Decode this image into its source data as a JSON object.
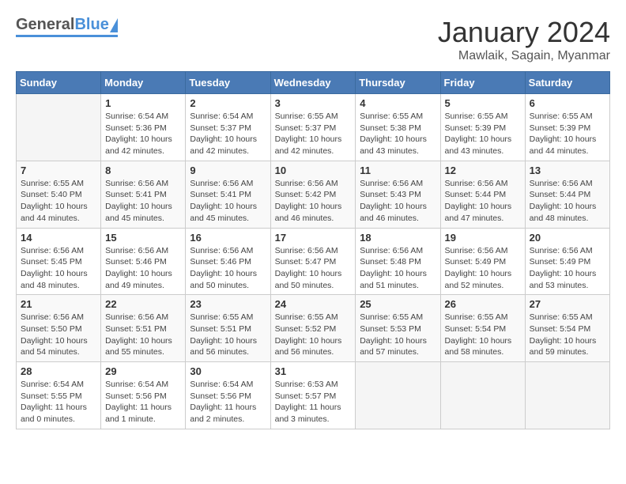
{
  "header": {
    "logo_general": "General",
    "logo_blue": "Blue",
    "month_title": "January 2024",
    "location": "Mawlaik, Sagain, Myanmar"
  },
  "days_of_week": [
    "Sunday",
    "Monday",
    "Tuesday",
    "Wednesday",
    "Thursday",
    "Friday",
    "Saturday"
  ],
  "weeks": [
    [
      {
        "day": "",
        "sunrise": "",
        "sunset": "",
        "daylight": ""
      },
      {
        "day": "1",
        "sunrise": "Sunrise: 6:54 AM",
        "sunset": "Sunset: 5:36 PM",
        "daylight": "Daylight: 10 hours and 42 minutes."
      },
      {
        "day": "2",
        "sunrise": "Sunrise: 6:54 AM",
        "sunset": "Sunset: 5:37 PM",
        "daylight": "Daylight: 10 hours and 42 minutes."
      },
      {
        "day": "3",
        "sunrise": "Sunrise: 6:55 AM",
        "sunset": "Sunset: 5:37 PM",
        "daylight": "Daylight: 10 hours and 42 minutes."
      },
      {
        "day": "4",
        "sunrise": "Sunrise: 6:55 AM",
        "sunset": "Sunset: 5:38 PM",
        "daylight": "Daylight: 10 hours and 43 minutes."
      },
      {
        "day": "5",
        "sunrise": "Sunrise: 6:55 AM",
        "sunset": "Sunset: 5:39 PM",
        "daylight": "Daylight: 10 hours and 43 minutes."
      },
      {
        "day": "6",
        "sunrise": "Sunrise: 6:55 AM",
        "sunset": "Sunset: 5:39 PM",
        "daylight": "Daylight: 10 hours and 44 minutes."
      }
    ],
    [
      {
        "day": "7",
        "sunrise": "Sunrise: 6:55 AM",
        "sunset": "Sunset: 5:40 PM",
        "daylight": "Daylight: 10 hours and 44 minutes."
      },
      {
        "day": "8",
        "sunrise": "Sunrise: 6:56 AM",
        "sunset": "Sunset: 5:41 PM",
        "daylight": "Daylight: 10 hours and 45 minutes."
      },
      {
        "day": "9",
        "sunrise": "Sunrise: 6:56 AM",
        "sunset": "Sunset: 5:41 PM",
        "daylight": "Daylight: 10 hours and 45 minutes."
      },
      {
        "day": "10",
        "sunrise": "Sunrise: 6:56 AM",
        "sunset": "Sunset: 5:42 PM",
        "daylight": "Daylight: 10 hours and 46 minutes."
      },
      {
        "day": "11",
        "sunrise": "Sunrise: 6:56 AM",
        "sunset": "Sunset: 5:43 PM",
        "daylight": "Daylight: 10 hours and 46 minutes."
      },
      {
        "day": "12",
        "sunrise": "Sunrise: 6:56 AM",
        "sunset": "Sunset: 5:44 PM",
        "daylight": "Daylight: 10 hours and 47 minutes."
      },
      {
        "day": "13",
        "sunrise": "Sunrise: 6:56 AM",
        "sunset": "Sunset: 5:44 PM",
        "daylight": "Daylight: 10 hours and 48 minutes."
      }
    ],
    [
      {
        "day": "14",
        "sunrise": "Sunrise: 6:56 AM",
        "sunset": "Sunset: 5:45 PM",
        "daylight": "Daylight: 10 hours and 48 minutes."
      },
      {
        "day": "15",
        "sunrise": "Sunrise: 6:56 AM",
        "sunset": "Sunset: 5:46 PM",
        "daylight": "Daylight: 10 hours and 49 minutes."
      },
      {
        "day": "16",
        "sunrise": "Sunrise: 6:56 AM",
        "sunset": "Sunset: 5:46 PM",
        "daylight": "Daylight: 10 hours and 50 minutes."
      },
      {
        "day": "17",
        "sunrise": "Sunrise: 6:56 AM",
        "sunset": "Sunset: 5:47 PM",
        "daylight": "Daylight: 10 hours and 50 minutes."
      },
      {
        "day": "18",
        "sunrise": "Sunrise: 6:56 AM",
        "sunset": "Sunset: 5:48 PM",
        "daylight": "Daylight: 10 hours and 51 minutes."
      },
      {
        "day": "19",
        "sunrise": "Sunrise: 6:56 AM",
        "sunset": "Sunset: 5:49 PM",
        "daylight": "Daylight: 10 hours and 52 minutes."
      },
      {
        "day": "20",
        "sunrise": "Sunrise: 6:56 AM",
        "sunset": "Sunset: 5:49 PM",
        "daylight": "Daylight: 10 hours and 53 minutes."
      }
    ],
    [
      {
        "day": "21",
        "sunrise": "Sunrise: 6:56 AM",
        "sunset": "Sunset: 5:50 PM",
        "daylight": "Daylight: 10 hours and 54 minutes."
      },
      {
        "day": "22",
        "sunrise": "Sunrise: 6:56 AM",
        "sunset": "Sunset: 5:51 PM",
        "daylight": "Daylight: 10 hours and 55 minutes."
      },
      {
        "day": "23",
        "sunrise": "Sunrise: 6:55 AM",
        "sunset": "Sunset: 5:51 PM",
        "daylight": "Daylight: 10 hours and 56 minutes."
      },
      {
        "day": "24",
        "sunrise": "Sunrise: 6:55 AM",
        "sunset": "Sunset: 5:52 PM",
        "daylight": "Daylight: 10 hours and 56 minutes."
      },
      {
        "day": "25",
        "sunrise": "Sunrise: 6:55 AM",
        "sunset": "Sunset: 5:53 PM",
        "daylight": "Daylight: 10 hours and 57 minutes."
      },
      {
        "day": "26",
        "sunrise": "Sunrise: 6:55 AM",
        "sunset": "Sunset: 5:54 PM",
        "daylight": "Daylight: 10 hours and 58 minutes."
      },
      {
        "day": "27",
        "sunrise": "Sunrise: 6:55 AM",
        "sunset": "Sunset: 5:54 PM",
        "daylight": "Daylight: 10 hours and 59 minutes."
      }
    ],
    [
      {
        "day": "28",
        "sunrise": "Sunrise: 6:54 AM",
        "sunset": "Sunset: 5:55 PM",
        "daylight": "Daylight: 11 hours and 0 minutes."
      },
      {
        "day": "29",
        "sunrise": "Sunrise: 6:54 AM",
        "sunset": "Sunset: 5:56 PM",
        "daylight": "Daylight: 11 hours and 1 minute."
      },
      {
        "day": "30",
        "sunrise": "Sunrise: 6:54 AM",
        "sunset": "Sunset: 5:56 PM",
        "daylight": "Daylight: 11 hours and 2 minutes."
      },
      {
        "day": "31",
        "sunrise": "Sunrise: 6:53 AM",
        "sunset": "Sunset: 5:57 PM",
        "daylight": "Daylight: 11 hours and 3 minutes."
      },
      {
        "day": "",
        "sunrise": "",
        "sunset": "",
        "daylight": ""
      },
      {
        "day": "",
        "sunrise": "",
        "sunset": "",
        "daylight": ""
      },
      {
        "day": "",
        "sunrise": "",
        "sunset": "",
        "daylight": ""
      }
    ]
  ]
}
